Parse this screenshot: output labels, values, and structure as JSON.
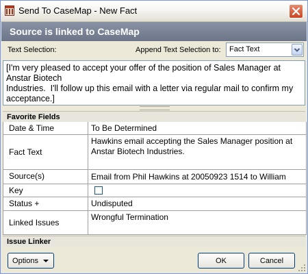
{
  "window": {
    "title": "Send To CaseMap - New Fact"
  },
  "header": {
    "source_text": "Source  is linked to CaseMap"
  },
  "selection": {
    "text_selection_label": "Text Selection:",
    "append_label": "Append Text Selection to:",
    "append_value": "Fact Text",
    "text": "[I'm very pleased to accept your offer of the position of Sales Manager at Anstar Biotech\nIndustries.  I'll follow up this email with a letter via regular mail to confirm my acceptance.]"
  },
  "favorite_fields": {
    "header": "Favorite Fields",
    "rows": [
      {
        "label": "Date & Time",
        "value": "To Be Determined"
      },
      {
        "label": "Fact Text",
        "value": "Hawkins email accepting the Sales Manager position at Anstar Biotech Industries."
      },
      {
        "label": "Source(s)",
        "value": "Email from Phil Hawkins at 20050923 1514 to William"
      },
      {
        "label": "Key",
        "value": "",
        "checked": false
      },
      {
        "label": "Status +",
        "value": "Undisputed"
      },
      {
        "label": "Linked Issues",
        "value": "Wrongful Termination"
      }
    ]
  },
  "issue_linker": {
    "header": "Issue Linker"
  },
  "buttons": {
    "options": "Options",
    "ok": "OK",
    "cancel": "Cancel"
  },
  "colors": {
    "header_band": "#7b8497",
    "close_button": "#d35a37",
    "border": "#7a96df"
  }
}
